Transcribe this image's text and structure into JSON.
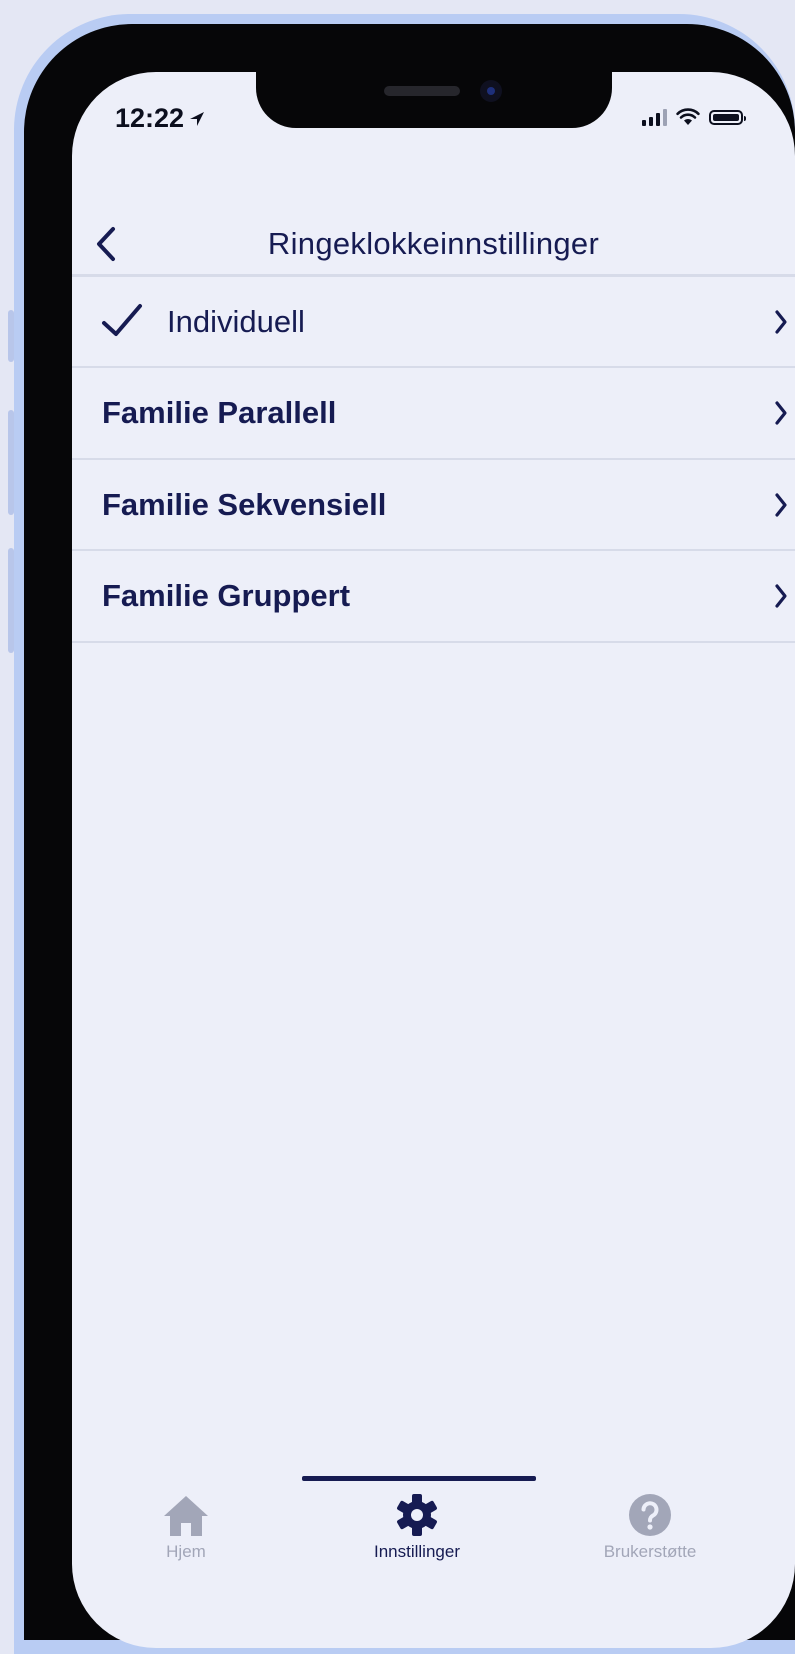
{
  "status_bar": {
    "time": "12:22"
  },
  "header": {
    "title": "Ringeklokkeinnstillinger"
  },
  "menu": {
    "items": [
      {
        "label": "Individuell",
        "selected": true
      },
      {
        "label": "Familie Parallell",
        "selected": false
      },
      {
        "label": "Familie Sekvensiell",
        "selected": false
      },
      {
        "label": "Familie Gruppert",
        "selected": false
      }
    ]
  },
  "tabbar": {
    "tabs": [
      {
        "label": "Hjem",
        "icon": "home-icon",
        "active": false
      },
      {
        "label": "Innstillinger",
        "icon": "gear-icon",
        "active": true
      },
      {
        "label": "Brukerstøtte",
        "icon": "help-icon",
        "active": false
      }
    ]
  },
  "colors": {
    "primary": "#161b52",
    "background": "#edeff9",
    "divider": "#d7dbe9",
    "inactive": "#a2a6b8",
    "frame": "#b9ccf3"
  }
}
